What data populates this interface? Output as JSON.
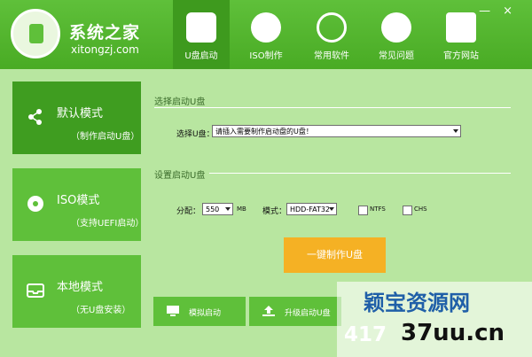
{
  "brand": {
    "name": "系统之家",
    "domain": "xitongzj.com"
  },
  "window": {
    "minimize": "—",
    "close": "×"
  },
  "nav": {
    "tabs": [
      {
        "label": "U盘启动",
        "icon": "usb-drive-icon"
      },
      {
        "label": "ISO制作",
        "icon": "disc-icon"
      },
      {
        "label": "常用软件",
        "icon": "apps-icon"
      },
      {
        "label": "常见问题",
        "icon": "info-icon"
      },
      {
        "label": "官方网站",
        "icon": "home-icon"
      }
    ]
  },
  "sidebar": {
    "modes": [
      {
        "title": "默认模式",
        "subtitle": "（制作启动U盘）",
        "icon": "share-icon"
      },
      {
        "title": "ISO模式",
        "subtitle": "（支持UEFI启动）",
        "icon": "disc-icon"
      },
      {
        "title": "本地模式",
        "subtitle": "（无U盘安装）",
        "icon": "tray-icon"
      }
    ]
  },
  "select_usb": {
    "section_title": "选择启动U盘",
    "label": "选择U盘：",
    "value": "请插入需要制作启动盘的U盘！"
  },
  "boot_settings": {
    "section_title": "设置启动U盘",
    "partition_label": "分配：",
    "partition_value": "550",
    "unit": "MB",
    "mode_label": "模式：",
    "mode_value": "HDD-FAT32",
    "ntfs": "NTFS",
    "chs": "CHS"
  },
  "actions": {
    "make": "一键制作U盘",
    "simulate": "模拟启动",
    "upgrade": "升级启动U盘"
  },
  "watermark": {
    "chinese": "颖宝资源网",
    "number": "417",
    "site": "37uu.cn"
  },
  "colors": {
    "primary_green": "#5fc03a",
    "dark_green": "#3f9d20",
    "accent_orange": "#f5b124"
  }
}
